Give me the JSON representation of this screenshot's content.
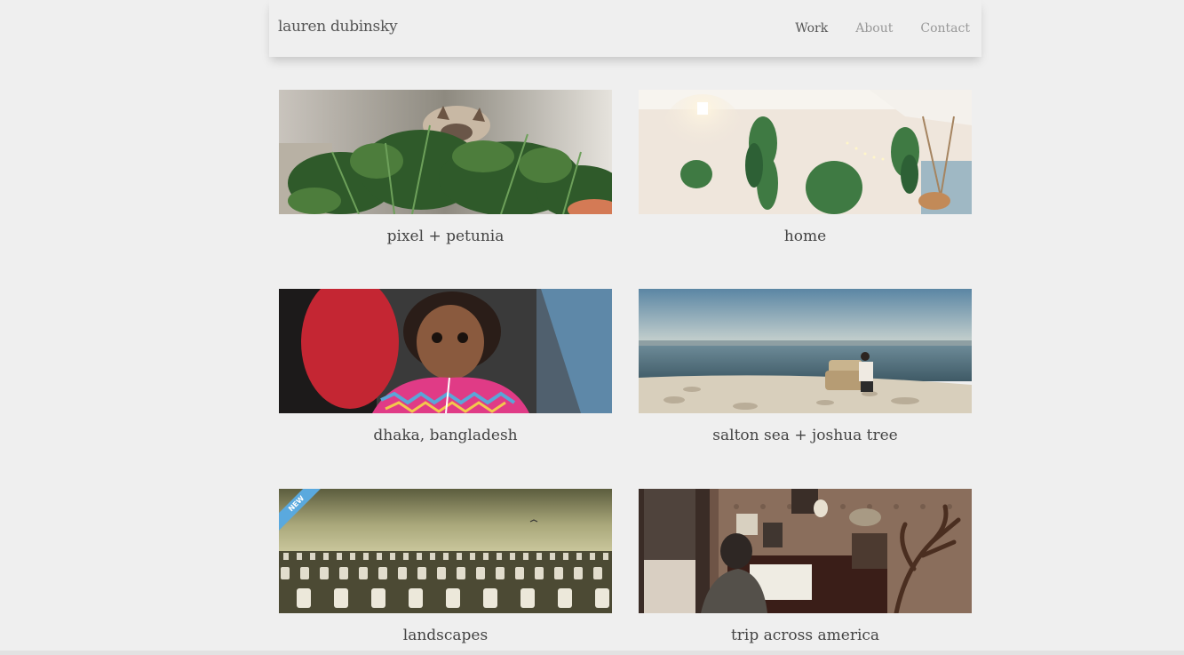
{
  "header": {
    "logo": "lauren dubinsky",
    "nav": [
      {
        "label": "Work"
      },
      {
        "label": "About"
      },
      {
        "label": "Contact"
      }
    ]
  },
  "projects": [
    {
      "title": "pixel + petunia",
      "icon": "fern-plants-photo"
    },
    {
      "title": "home",
      "icon": "hanging-plants-photo"
    },
    {
      "title": "dhaka, bangladesh",
      "icon": "child-portrait-photo"
    },
    {
      "title": "salton sea + joshua tree",
      "icon": "beach-armchair-photo"
    },
    {
      "title": "landscapes",
      "icon": "cemetery-photo",
      "badge": "NEW"
    },
    {
      "title": "trip across america",
      "icon": "piano-room-photo"
    }
  ],
  "colors": {
    "background": "#efefef",
    "badge": "#5aa9de"
  }
}
